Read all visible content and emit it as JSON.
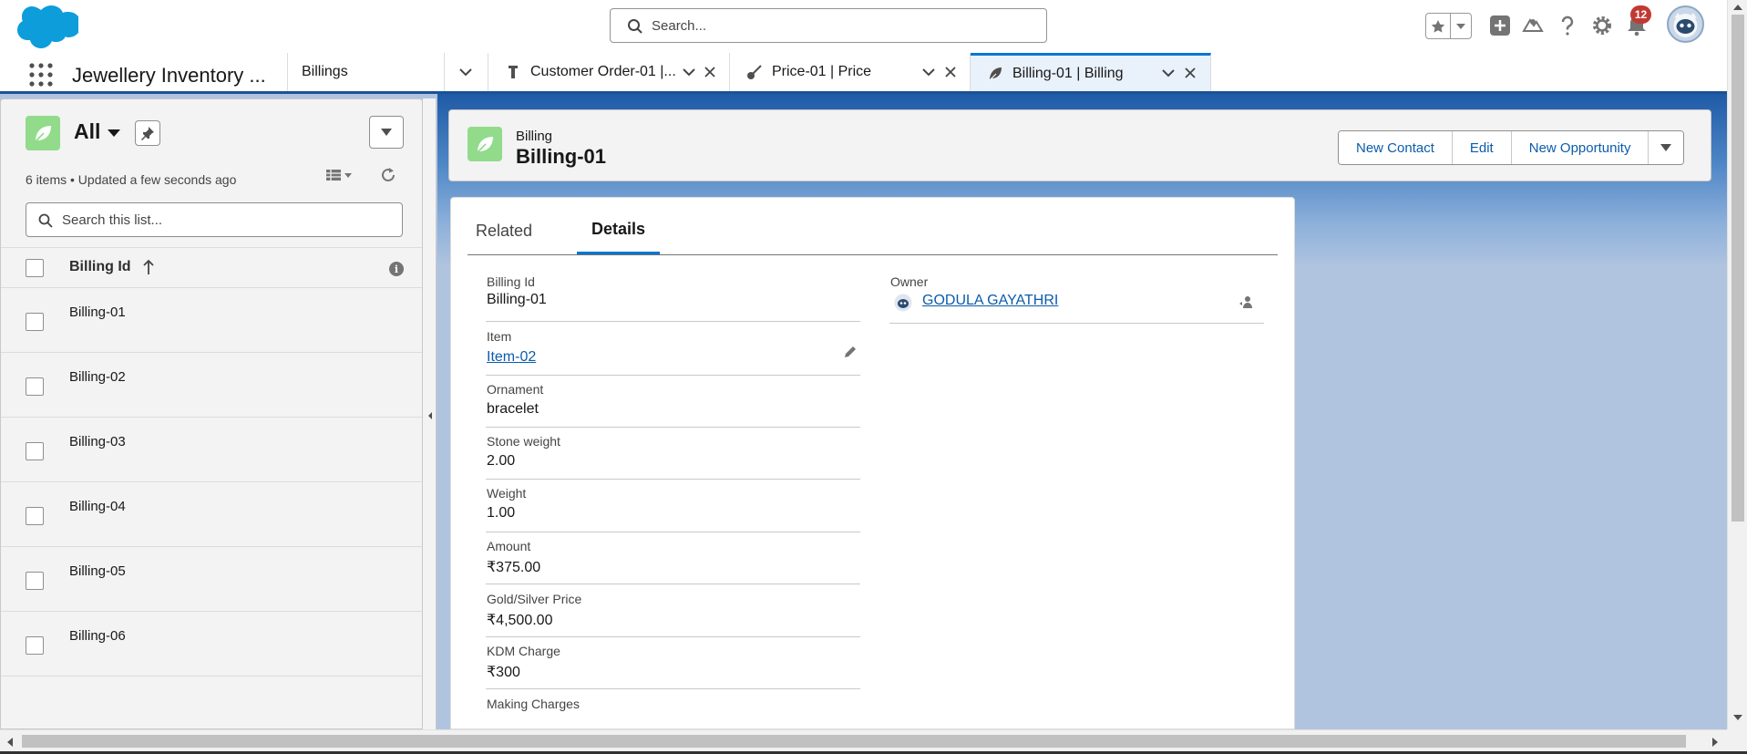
{
  "global_header": {
    "search_placeholder": "Search...",
    "notification_count": "12"
  },
  "nav": {
    "app_name": "Jewellery Inventory ...",
    "object_item": "Billings",
    "tabs": [
      {
        "label": "Customer Order-01 |...",
        "icon": "wrench-icon"
      },
      {
        "label": "Price-01 | Price",
        "icon": "guitar-icon"
      },
      {
        "label": "Billing-01 | Billing",
        "icon": "leaf-icon",
        "active": true
      }
    ]
  },
  "list_view": {
    "name": "All",
    "meta": "6 items • Updated a few seconds ago",
    "search_placeholder": "Search this list...",
    "column_header": "Billing Id",
    "rows": [
      "Billing-01",
      "Billing-02",
      "Billing-03",
      "Billing-04",
      "Billing-05",
      "Billing-06"
    ]
  },
  "record": {
    "object_label": "Billing",
    "title": "Billing-01",
    "actions": [
      "New Contact",
      "Edit",
      "New Opportunity"
    ],
    "tabs": [
      "Related",
      "Details"
    ],
    "active_tab": "Details",
    "fields_left": [
      {
        "label": "Billing Id",
        "value": "Billing-01"
      },
      {
        "label": "Item",
        "value": "Item-02",
        "link": true
      },
      {
        "label": "Ornament",
        "value": "bracelet"
      },
      {
        "label": "Stone weight",
        "value": "2.00"
      },
      {
        "label": "Weight",
        "value": "1.00"
      },
      {
        "label": "Amount",
        "value": "₹375.00"
      },
      {
        "label": "Gold/Silver Price",
        "value": "₹4,500.00"
      },
      {
        "label": "KDM Charge",
        "value": "₹300"
      },
      {
        "label": "Making Charges",
        "value": ""
      }
    ],
    "owner": {
      "label": "Owner",
      "value": "GODULA GAYATHRI"
    }
  },
  "colors": {
    "brand_blue": "#0176d3",
    "link_blue": "#0b5cab",
    "object_green": "#91db8b",
    "badge_red": "#c23934"
  }
}
